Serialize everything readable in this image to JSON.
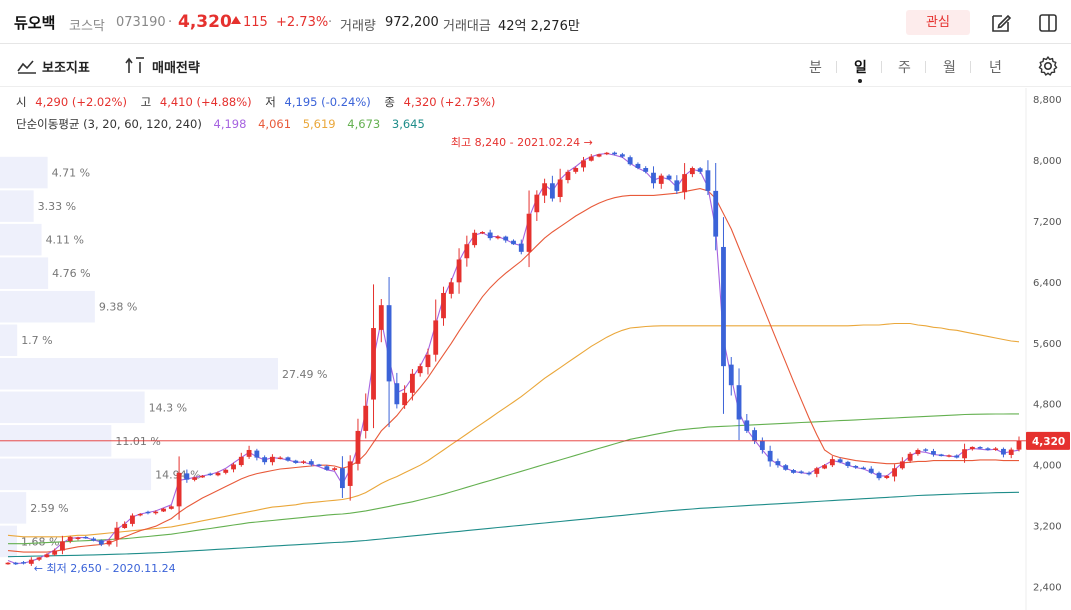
{
  "header": {
    "name": "듀오백",
    "market": "코스닥",
    "code": "073190",
    "separator": "·",
    "price": "4,320",
    "change": "115",
    "change_pct": "+2.73%",
    "volume_label": "거래량",
    "volume": "972,200",
    "amount_label": "거래대금",
    "amount": "42억 2,276만",
    "favorite_label": "관심"
  },
  "toolbar": {
    "indicators_label": "보조지표",
    "strategy_label": "매매전략",
    "periods": [
      "분",
      "일",
      "주",
      "월",
      "년"
    ],
    "active_period": "일"
  },
  "ohlc": {
    "open_label": "시",
    "open": "4,290 (+2.02%)",
    "high_label": "고",
    "high": "4,410 (+4.88%)",
    "low_label": "저",
    "low": "4,195 (-0.24%)",
    "close_label": "종",
    "close": "4,320 (+2.73%)"
  },
  "ma_legend": {
    "label": "단순이동평균 (3, 20, 60, 120, 240)",
    "values": [
      "4,198",
      "4,061",
      "5,619",
      "4,673",
      "3,645"
    ]
  },
  "colors": {
    "up": "#e5312e",
    "down": "#3b63d8",
    "ma3": "#a663e0",
    "ma20": "#e85a3a",
    "ma60": "#eaa73a",
    "ma120": "#64b050",
    "ma240": "#1f8d8a",
    "volume_profile": "#eef0fb"
  },
  "chart_data": {
    "type": "candlestick",
    "y_ticks": [
      "8,800",
      "8,000",
      "7,200",
      "6,400",
      "5,600",
      "4,800",
      "4,000",
      "3,200",
      "2,400"
    ],
    "y_tick_values": [
      8800,
      8000,
      7200,
      6400,
      5600,
      4800,
      4000,
      3200,
      2400
    ],
    "ylim": [
      2100,
      8950
    ],
    "current_price": 4320,
    "current_price_label": "4,320",
    "high_annotation": "최고 8,240 - 2021.02.24",
    "low_annotation": "최저 2,650 - 2020.11.24",
    "volume_profile": [
      {
        "price_top": 8060,
        "price_bottom": 7620,
        "share": 4.71,
        "label": "4.71 %"
      },
      {
        "price_top": 7620,
        "price_bottom": 7180,
        "share": 3.33,
        "label": "3.33 %"
      },
      {
        "price_top": 7180,
        "price_bottom": 6740,
        "share": 4.11,
        "label": "4.11 %"
      },
      {
        "price_top": 6740,
        "price_bottom": 6300,
        "share": 4.76,
        "label": "4.76 %"
      },
      {
        "price_top": 6300,
        "price_bottom": 5860,
        "share": 9.38,
        "label": "9.38 %"
      },
      {
        "price_top": 5860,
        "price_bottom": 5420,
        "share": 1.7,
        "label": "1.7 %"
      },
      {
        "price_top": 5420,
        "price_bottom": 4980,
        "share": 27.49,
        "label": "27.49 %"
      },
      {
        "price_top": 4980,
        "price_bottom": 4540,
        "share": 14.3,
        "label": "14.3 %"
      },
      {
        "price_top": 4540,
        "price_bottom": 4100,
        "share": 11.01,
        "label": "11.01 %"
      },
      {
        "price_top": 4100,
        "price_bottom": 3660,
        "share": 14.94,
        "label": "14.94 %"
      },
      {
        "price_top": 3660,
        "price_bottom": 3220,
        "share": 2.59,
        "label": "2.59 %"
      },
      {
        "price_top": 3220,
        "price_bottom": 2780,
        "share": 1.68,
        "label": "1.68 %"
      }
    ],
    "closes": [
      2720,
      2700,
      2710,
      2760,
      2790,
      2830,
      2880,
      3000,
      3060,
      3050,
      3040,
      3010,
      2960,
      3010,
      3180,
      3230,
      3340,
      3360,
      3370,
      3390,
      3430,
      3460,
      3900,
      3810,
      3840,
      3860,
      3870,
      3900,
      3940,
      4010,
      4110,
      4200,
      4100,
      4040,
      4110,
      4100,
      4060,
      4030,
      4050,
      4010,
      3990,
      3940,
      3960,
      3700,
      4050,
      4450,
      4780,
      5800,
      6100,
      5100,
      4800,
      4950,
      5200,
      5300,
      5450,
      5900,
      6260,
      6400,
      6700,
      6900,
      7050,
      7060,
      6980,
      7000,
      6950,
      6900,
      6800,
      7300,
      7550,
      7700,
      7500,
      7750,
      7850,
      7900,
      8000,
      8050,
      8080,
      8100,
      8080,
      8050,
      7950,
      7900,
      7850,
      7700,
      7800,
      7750,
      7600,
      7820,
      7900,
      7850,
      7600,
      7000,
      5300,
      5050,
      4600,
      4450,
      4320,
      4200,
      4050,
      4000,
      3940,
      3900,
      3900,
      3880,
      3960,
      4000,
      4080,
      4040,
      3990,
      3970,
      3950,
      3900,
      3830,
      3860,
      3960,
      4050,
      4150,
      4200,
      4190,
      4140,
      4120,
      4130,
      4100,
      4210,
      4240,
      4220,
      4200,
      4220,
      4140,
      4205,
      4320
    ],
    "ma_lines": {
      "ma3": [
        2750,
        2710,
        2715,
        2740,
        2780,
        2830,
        2890,
        2980,
        3040,
        3050,
        3050,
        3020,
        2990,
        3030,
        3160,
        3230,
        3320,
        3360,
        3380,
        3400,
        3440,
        3480,
        3800,
        3820,
        3840,
        3860,
        3880,
        3910,
        3960,
        4030,
        4100,
        4170,
        4110,
        4070,
        4100,
        4090,
        4070,
        4040,
        4040,
        4010,
        3980,
        3940,
        3920,
        3750,
        3950,
        4250,
        4700,
        5400,
        5900,
        5400,
        4950,
        5000,
        5150,
        5300,
        5500,
        5850,
        6200,
        6420,
        6680,
        6870,
        7020,
        7050,
        7000,
        7000,
        6960,
        6910,
        6880,
        7250,
        7500,
        7680,
        7600,
        7750,
        7850,
        7920,
        8000,
        8050,
        8080,
        8090,
        8070,
        8040,
        7960,
        7900,
        7850,
        7740,
        7780,
        7750,
        7650,
        7800,
        7880,
        7860,
        7650,
        7100,
        5650,
        5150,
        4700,
        4470,
        4330,
        4200,
        4080,
        4010,
        3960,
        3920,
        3900,
        3890,
        3950,
        4000,
        4060,
        4040,
        4000,
        3970,
        3950,
        3910,
        3860,
        3860,
        3940,
        4030,
        4120,
        4180,
        4170,
        4140,
        4130,
        4120,
        4110,
        4190,
        4220,
        4210,
        4200,
        4210,
        4160,
        4180,
        4198
      ],
      "ma20": [
        2880,
        2870,
        2860,
        2860,
        2860,
        2860,
        2870,
        2890,
        2910,
        2930,
        2940,
        2950,
        2960,
        2980,
        3020,
        3060,
        3100,
        3140,
        3170,
        3200,
        3250,
        3300,
        3380,
        3450,
        3510,
        3570,
        3620,
        3670,
        3720,
        3770,
        3820,
        3860,
        3890,
        3910,
        3930,
        3950,
        3960,
        3970,
        3980,
        3990,
        4000,
        4000,
        3990,
        3960,
        3990,
        4050,
        4150,
        4300,
        4450,
        4550,
        4650,
        4780,
        4900,
        5020,
        5150,
        5300,
        5450,
        5600,
        5760,
        5910,
        6060,
        6210,
        6330,
        6430,
        6520,
        6600,
        6680,
        6780,
        6880,
        6980,
        7060,
        7130,
        7200,
        7270,
        7330,
        7390,
        7440,
        7480,
        7510,
        7530,
        7540,
        7540,
        7540,
        7540,
        7550,
        7560,
        7570,
        7590,
        7610,
        7630,
        7600,
        7500,
        7300,
        7100,
        6850,
        6600,
        6350,
        6100,
        5850,
        5600,
        5350,
        5100,
        4860,
        4620,
        4400,
        4200,
        4130,
        4100,
        4080,
        4060,
        4050,
        4040,
        4030,
        4020,
        4020,
        4030,
        4040,
        4050,
        4050,
        4060,
        4060,
        4060,
        4060,
        4060,
        4060,
        4070,
        4070,
        4070,
        4060,
        4060,
        4061
      ],
      "ma60": [
        3080,
        3070,
        3060,
        3060,
        3060,
        3060,
        3060,
        3060,
        3070,
        3080,
        3080,
        3090,
        3100,
        3110,
        3120,
        3130,
        3140,
        3150,
        3160,
        3170,
        3180,
        3190,
        3210,
        3230,
        3250,
        3270,
        3290,
        3310,
        3330,
        3350,
        3370,
        3390,
        3410,
        3430,
        3450,
        3460,
        3470,
        3480,
        3500,
        3510,
        3520,
        3530,
        3540,
        3550,
        3570,
        3600,
        3640,
        3700,
        3760,
        3810,
        3850,
        3900,
        3950,
        4000,
        4060,
        4130,
        4200,
        4270,
        4340,
        4410,
        4480,
        4550,
        4620,
        4690,
        4760,
        4830,
        4900,
        4980,
        5060,
        5140,
        5210,
        5280,
        5350,
        5420,
        5490,
        5560,
        5620,
        5680,
        5730,
        5770,
        5800,
        5810,
        5820,
        5825,
        5830,
        5830,
        5830,
        5830,
        5830,
        5830,
        5830,
        5830,
        5830,
        5830,
        5830,
        5830,
        5830,
        5830,
        5830,
        5830,
        5830,
        5830,
        5830,
        5830,
        5830,
        5830,
        5830,
        5830,
        5830,
        5835,
        5840,
        5840,
        5840,
        5850,
        5860,
        5860,
        5860,
        5840,
        5830,
        5810,
        5800,
        5780,
        5770,
        5750,
        5730,
        5710,
        5690,
        5670,
        5650,
        5630,
        5619
      ],
      "ma120": [
        2970,
        2970,
        2970,
        2975,
        2980,
        2985,
        2990,
        2995,
        3000,
        3005,
        3010,
        3015,
        3020,
        3025,
        3030,
        3035,
        3045,
        3055,
        3065,
        3075,
        3085,
        3095,
        3110,
        3125,
        3140,
        3155,
        3170,
        3185,
        3200,
        3215,
        3230,
        3245,
        3255,
        3265,
        3275,
        3285,
        3295,
        3305,
        3315,
        3325,
        3335,
        3345,
        3355,
        3360,
        3370,
        3385,
        3400,
        3420,
        3440,
        3460,
        3480,
        3500,
        3520,
        3545,
        3570,
        3595,
        3620,
        3650,
        3680,
        3710,
        3740,
        3770,
        3800,
        3830,
        3860,
        3890,
        3920,
        3950,
        3980,
        4010,
        4040,
        4070,
        4100,
        4130,
        4160,
        4190,
        4220,
        4250,
        4280,
        4310,
        4340,
        4360,
        4380,
        4400,
        4420,
        4440,
        4460,
        4470,
        4480,
        4490,
        4500,
        4505,
        4510,
        4515,
        4520,
        4525,
        4530,
        4535,
        4540,
        4545,
        4550,
        4555,
        4560,
        4565,
        4570,
        4575,
        4580,
        4585,
        4590,
        4595,
        4600,
        4605,
        4610,
        4615,
        4620,
        4625,
        4630,
        4635,
        4640,
        4645,
        4650,
        4655,
        4660,
        4665,
        4668,
        4670,
        4671,
        4672,
        4672,
        4673,
        4673
      ],
      "ma240": [
        2800,
        2802,
        2804,
        2806,
        2808,
        2810,
        2812,
        2814,
        2816,
        2818,
        2820,
        2823,
        2826,
        2829,
        2832,
        2835,
        2839,
        2843,
        2847,
        2851,
        2855,
        2860,
        2866,
        2872,
        2878,
        2884,
        2890,
        2896,
        2902,
        2908,
        2914,
        2920,
        2926,
        2932,
        2938,
        2944,
        2950,
        2956,
        2962,
        2968,
        2974,
        2980,
        2986,
        2990,
        2996,
        3004,
        3012,
        3022,
        3032,
        3042,
        3052,
        3062,
        3072,
        3082,
        3092,
        3102,
        3112,
        3122,
        3132,
        3142,
        3152,
        3162,
        3172,
        3182,
        3192,
        3202,
        3212,
        3222,
        3232,
        3242,
        3252,
        3262,
        3272,
        3282,
        3292,
        3302,
        3312,
        3322,
        3332,
        3342,
        3352,
        3362,
        3372,
        3382,
        3392,
        3402,
        3410,
        3418,
        3426,
        3434,
        3440,
        3446,
        3452,
        3458,
        3464,
        3470,
        3476,
        3482,
        3488,
        3494,
        3500,
        3506,
        3512,
        3518,
        3524,
        3530,
        3536,
        3542,
        3548,
        3554,
        3560,
        3566,
        3572,
        3578,
        3584,
        3590,
        3596,
        3602,
        3606,
        3610,
        3614,
        3618,
        3622,
        3626,
        3630,
        3633,
        3636,
        3639,
        3641,
        3643,
        3645
      ]
    }
  }
}
